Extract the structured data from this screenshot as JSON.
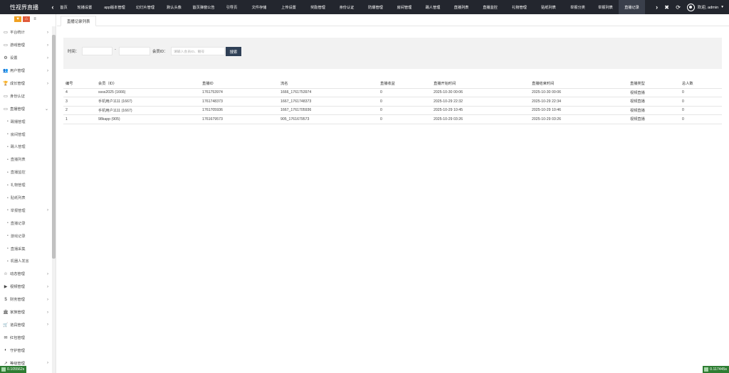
{
  "brand": "性视界直播",
  "nav": {
    "left_arrow": "‹",
    "right_arrow": "›",
    "tabs": [
      {
        "label": "首页",
        "w": 19
      },
      {
        "label": "轮播设置",
        "w": 40
      },
      {
        "label": "app版本管理",
        "w": 44
      },
      {
        "label": "幻灯片管理",
        "w": 42
      },
      {
        "label": "默认头像",
        "w": 39
      },
      {
        "label": "首页弹窗公告",
        "w": 44
      },
      {
        "label": "引导页",
        "w": 35
      },
      {
        "label": "文件存储",
        "w": 42
      },
      {
        "label": "上传设置",
        "w": 41
      },
      {
        "label": "奖励管理",
        "w": 41
      },
      {
        "label": "身份认证",
        "w": 40
      },
      {
        "label": "防爆管理",
        "w": 41
      },
      {
        "label": "房间管理",
        "w": 40
      },
      {
        "label": "踢人管理",
        "w": 40
      },
      {
        "label": "直播列表",
        "w": 40
      },
      {
        "label": "直播监控",
        "w": 41
      },
      {
        "label": "礼物管理",
        "w": 41
      },
      {
        "label": "贴纸列表",
        "w": 41
      },
      {
        "label": "举报分类",
        "w": 41
      },
      {
        "label": "举报列表",
        "w": 37
      },
      {
        "label": "直播记录",
        "w": 37
      }
    ],
    "active_index": 20
  },
  "tools": {
    "close": "✖",
    "refresh": "⟳"
  },
  "user": {
    "greeting": "欢迎, admin",
    "caret": "▾"
  },
  "sidebar": {
    "tool_buttons": [
      "♥",
      "⌂",
      "≡"
    ],
    "items": [
      {
        "label": "平台统计",
        "icon": "▭",
        "chev": "›",
        "sub": false
      },
      {
        "label": "游戏管理",
        "icon": "▭",
        "chev": "›",
        "sub": false
      },
      {
        "label": "设置",
        "icon": "⚙",
        "chev": "›",
        "sub": false
      },
      {
        "label": "用户管理",
        "icon": "👥",
        "chev": "›",
        "sub": false
      },
      {
        "label": "成长管理",
        "icon": "🏆",
        "chev": "›",
        "sub": false
      },
      {
        "label": "身份认证",
        "icon": "▭",
        "chev": "",
        "sub": false
      },
      {
        "label": "直播管理",
        "icon": "▭",
        "chev": "⌄",
        "sub": false
      },
      {
        "label": "踢播管理",
        "icon": "",
        "chev": "",
        "sub": true
      },
      {
        "label": "房间管理",
        "icon": "",
        "chev": "",
        "sub": true
      },
      {
        "label": "踢人管理",
        "icon": "",
        "chev": "",
        "sub": true
      },
      {
        "label": "直播列表",
        "icon": "",
        "chev": "",
        "sub": true
      },
      {
        "label": "直播监控",
        "icon": "",
        "chev": "",
        "sub": true
      },
      {
        "label": "礼物管理",
        "icon": "",
        "chev": "",
        "sub": true
      },
      {
        "label": "贴纸列表",
        "icon": "",
        "chev": "",
        "sub": true
      },
      {
        "label": "举报管理",
        "icon": "",
        "chev": "›",
        "sub": true
      },
      {
        "label": "直播记录",
        "icon": "",
        "chev": "",
        "sub": true
      },
      {
        "label": "游戏记录",
        "icon": "",
        "chev": "",
        "sub": true
      },
      {
        "label": "直播采集",
        "icon": "",
        "chev": "",
        "sub": true
      },
      {
        "label": "机器人发言",
        "icon": "",
        "chev": "",
        "sub": true
      },
      {
        "label": "动态管理",
        "icon": "☆",
        "chev": "›",
        "sub": false
      },
      {
        "label": "视频管理",
        "icon": "▶",
        "chev": "›",
        "sub": false
      },
      {
        "label": "财务管理",
        "icon": "$",
        "chev": "›",
        "sub": false
      },
      {
        "label": "家族管理",
        "icon": "🏛",
        "chev": "›",
        "sub": false
      },
      {
        "label": "道具管理",
        "icon": "🛒",
        "chev": "›",
        "sub": false
      },
      {
        "label": "红包管理",
        "icon": "✉",
        "chev": "",
        "sub": false
      },
      {
        "label": "守护管理",
        "icon": "◐",
        "chev": "",
        "sub": false
      },
      {
        "label": "等级管理",
        "icon": "↗",
        "chev": "›",
        "sub": false
      }
    ]
  },
  "page_tab": "直播记录列表",
  "filter": {
    "time_label": "时间：",
    "dash": "-",
    "member_label": "会员ID：",
    "member_placeholder": "请输入会员ID、靓号",
    "search_label": "搜索"
  },
  "table": {
    "headers": [
      "编号",
      "会员（ID）",
      "直播ID",
      "流名",
      "直播收益",
      "直播开始时间",
      "直播结束时间",
      "直播类型",
      "总人数"
    ],
    "rows": [
      [
        "4",
        "ssss2025 (1666)",
        "1761753974",
        "1666_1761753974",
        "0",
        "2025-10-30 00:06",
        "2025-10-30 00:06",
        "视频直播",
        "0"
      ],
      [
        "3",
        "手机用户1111 (1667)",
        "1761748373",
        "1667_1761748373",
        "0",
        "2025-10-29 22:32",
        "2025-10-29 22:34",
        "视频直播",
        "0"
      ],
      [
        "2",
        "手机用户1111 (1667)",
        "1761705936",
        "1667_1761705936",
        "0",
        "2025-10-29 10:45",
        "2025-10-29 10:46",
        "视频直播",
        "0"
      ],
      [
        "1",
        "98kapp (905)",
        "1761679573",
        "905_1761679573",
        "0",
        "2025-10-29 03:26",
        "2025-10-29 03:26",
        "视频直播",
        "0"
      ]
    ]
  },
  "footer": {
    "left_badge": "0.105562s",
    "right_badge": "0.117445s"
  }
}
